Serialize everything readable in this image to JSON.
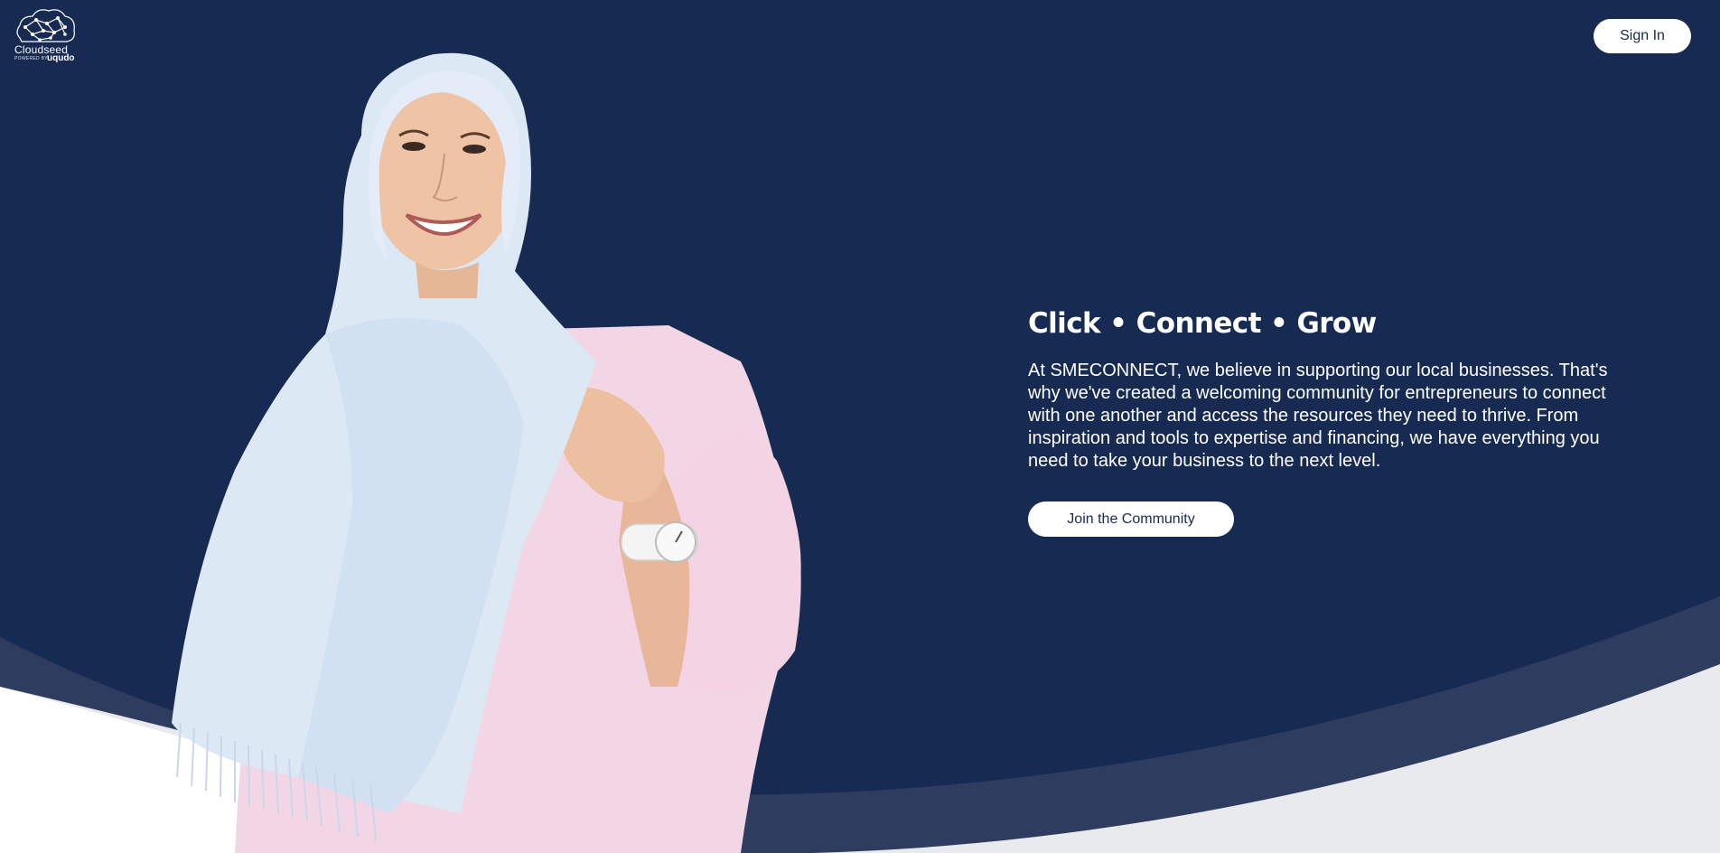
{
  "header": {
    "logo_text": "Cloudseed",
    "logo_powered_by": "POWERED BY",
    "logo_brand": "uqudo",
    "sign_in_label": "Sign In"
  },
  "hero": {
    "headline": "Click • Connect • Grow",
    "body": "At SMECONNECT, we believe in supporting our local businesses. That's why we've created a welcoming community for entrepreneurs to connect with one another and access the resources they need to thrive. From inspiration and tools to expertise and financing, we have everything you need to take your business to the next level.",
    "cta_label": "Join the Community"
  },
  "colors": {
    "navy": "#172a52",
    "navy_band": "#2e3d5f",
    "light_band": "#e9eaee",
    "white": "#ffffff"
  },
  "icons": {
    "logo": "cloud-network-icon"
  }
}
